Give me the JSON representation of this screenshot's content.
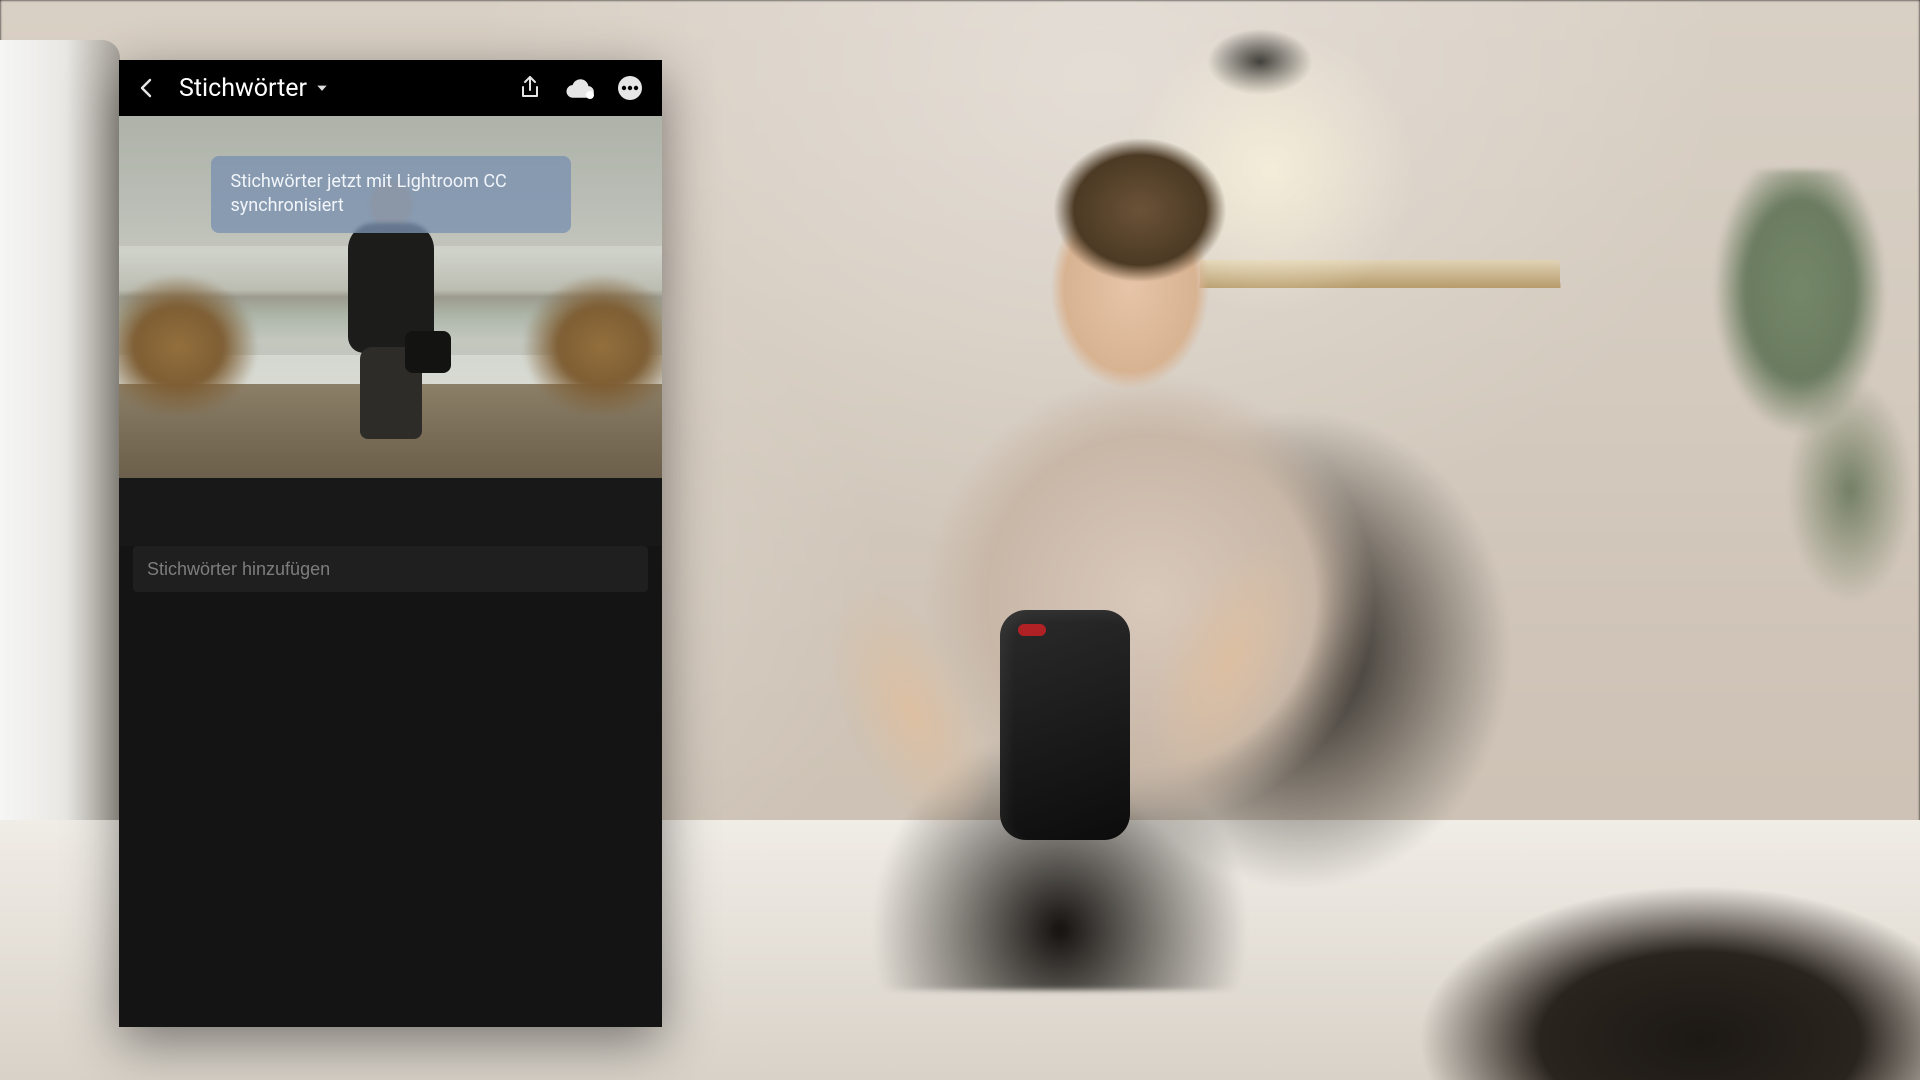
{
  "header": {
    "title": "Stichwörter"
  },
  "toast": {
    "message": "Stichwörter jetzt mit Lightroom CC synchronisiert"
  },
  "input": {
    "placeholder": "Stichwörter hinzufügen"
  },
  "icons": {
    "back": "back",
    "dropdown": "chevron-down",
    "share": "share",
    "cloud": "cloud-sync",
    "more": "more-horizontal"
  },
  "colors": {
    "app_bg": "#141414",
    "toolbar_bg": "#000000",
    "toast_bg": "rgba(122,145,176,0.78)",
    "input_bg": "#1f1f1f",
    "placeholder": "#7d7d7d",
    "text": "#ffffff"
  }
}
